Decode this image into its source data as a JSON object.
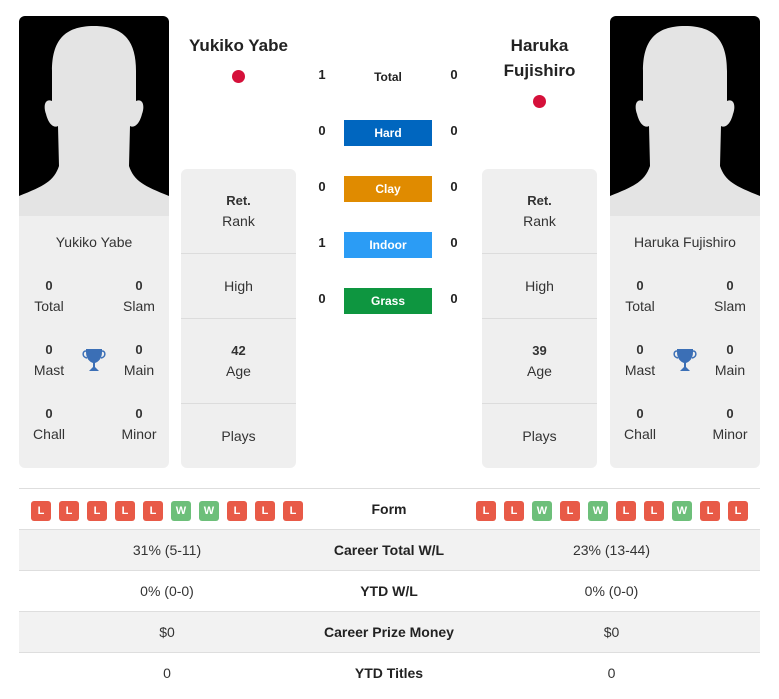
{
  "colors": {
    "hard": "#0066bf",
    "clay": "#e08b00",
    "indoor": "#2b9cf5",
    "grass": "#0e9640",
    "loss": "#e85a47",
    "win": "#6dbf7a",
    "flag_japan": "#d5103a",
    "trophy": "#3b6fb6"
  },
  "player1": {
    "name": "Yukiko Yabe",
    "card_name": "Yukiko Yabe",
    "country_flag": "japan-flag",
    "titles": {
      "total": "0",
      "total_label": "Total",
      "slam": "0",
      "slam_label": "Slam",
      "mast": "0",
      "mast_label": "Mast",
      "main": "0",
      "main_label": "Main",
      "chall": "0",
      "chall_label": "Chall",
      "minor": "0",
      "minor_label": "Minor"
    },
    "info": {
      "rank_value": "Ret.",
      "rank_label": "Rank",
      "high_label": "High",
      "age_value": "42",
      "age_label": "Age",
      "plays_label": "Plays"
    },
    "form": [
      "L",
      "L",
      "L",
      "L",
      "L",
      "W",
      "W",
      "L",
      "L",
      "L"
    ],
    "career_total_wl": "31% (5-11)",
    "ytd_wl": "0% (0-0)",
    "career_prize_money": "$0",
    "ytd_titles": "0"
  },
  "player2": {
    "name": "Haruka Fujishiro",
    "name_line1": "Haruka",
    "name_line2": "Fujishiro",
    "card_name": "Haruka Fujishiro",
    "country_flag": "japan-flag",
    "titles": {
      "total": "0",
      "total_label": "Total",
      "slam": "0",
      "slam_label": "Slam",
      "mast": "0",
      "mast_label": "Mast",
      "main": "0",
      "main_label": "Main",
      "chall": "0",
      "chall_label": "Chall",
      "minor": "0",
      "minor_label": "Minor"
    },
    "info": {
      "rank_value": "Ret.",
      "rank_label": "Rank",
      "high_label": "High",
      "age_value": "39",
      "age_label": "Age",
      "plays_label": "Plays"
    },
    "form": [
      "L",
      "L",
      "W",
      "L",
      "W",
      "L",
      "L",
      "W",
      "L",
      "L"
    ],
    "career_total_wl": "23% (13-44)",
    "ytd_wl": "0% (0-0)",
    "career_prize_money": "$0",
    "ytd_titles": "0"
  },
  "h2h": {
    "total": {
      "label": "Total",
      "p1": "1",
      "p2": "0"
    },
    "surfaces": [
      {
        "label": "Hard",
        "p1": "0",
        "p2": "0"
      },
      {
        "label": "Clay",
        "p1": "0",
        "p2": "0"
      },
      {
        "label": "Indoor",
        "p1": "1",
        "p2": "0"
      },
      {
        "label": "Grass",
        "p1": "0",
        "p2": "0"
      }
    ]
  },
  "table": {
    "form_label": "Form",
    "career_total_label": "Career Total W/L",
    "ytd_wl_label": "YTD W/L",
    "prize_label": "Career Prize Money",
    "ytd_titles_label": "YTD Titles"
  }
}
